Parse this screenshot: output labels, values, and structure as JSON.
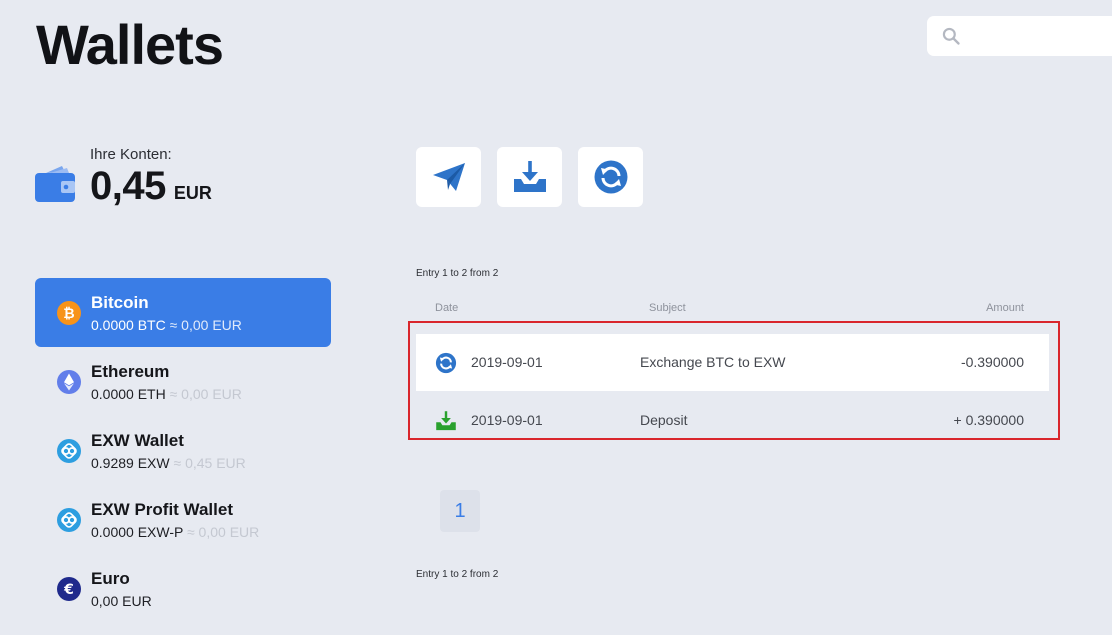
{
  "header": {
    "title": "Wallets",
    "search_placeholder": ""
  },
  "balance": {
    "label": "Ihre Konten:",
    "amount": "0,45",
    "currency": "EUR"
  },
  "actions": [
    {
      "name": "send",
      "icon": "paper-plane-icon"
    },
    {
      "name": "deposit",
      "icon": "download-tray-icon"
    },
    {
      "name": "exchange",
      "icon": "refresh-circle-icon"
    }
  ],
  "wallets": [
    {
      "name": "Bitcoin",
      "balance": "0.0000 BTC",
      "approx": "≈ 0,00 EUR",
      "icon": "bitcoin-icon",
      "active": true
    },
    {
      "name": "Ethereum",
      "balance": "0.0000 ETH",
      "approx": "≈ 0,00 EUR",
      "icon": "ethereum-icon",
      "active": false
    },
    {
      "name": "EXW Wallet",
      "balance": "0.9289 EXW",
      "approx": "≈ 0,45 EUR",
      "icon": "exw-icon",
      "active": false
    },
    {
      "name": "EXW Profit Wallet",
      "balance": "0.0000 EXW-P",
      "approx": "≈ 0,00 EUR",
      "icon": "exw-icon",
      "active": false
    },
    {
      "name": "Euro",
      "balance": "0,00 EUR",
      "approx": "",
      "icon": "euro-icon",
      "active": false
    }
  ],
  "entries_info_top": "Entry 1 to 2 from 2",
  "entries_info_bottom": "Entry 1 to 2 from 2",
  "table": {
    "columns": [
      "Date",
      "Subject",
      "Amount"
    ],
    "rows": [
      {
        "icon": "exchange-icon",
        "date": "2019-09-01",
        "subject": "Exchange BTC to EXW",
        "amount": "-0.390000"
      },
      {
        "icon": "deposit-icon",
        "date": "2019-09-01",
        "subject": "Deposit",
        "amount": "+ 0.390000"
      }
    ]
  },
  "pagination": {
    "current_page": "1"
  },
  "colors": {
    "accent": "#3a7de6",
    "background": "#e7eaf1",
    "highlight": "#d9262c",
    "bitcoin": "#f7931a",
    "ethereum": "#627eea",
    "exw": "#2d9ee0",
    "euro": "#1f2a8c",
    "deposit": "#2aa12e"
  }
}
